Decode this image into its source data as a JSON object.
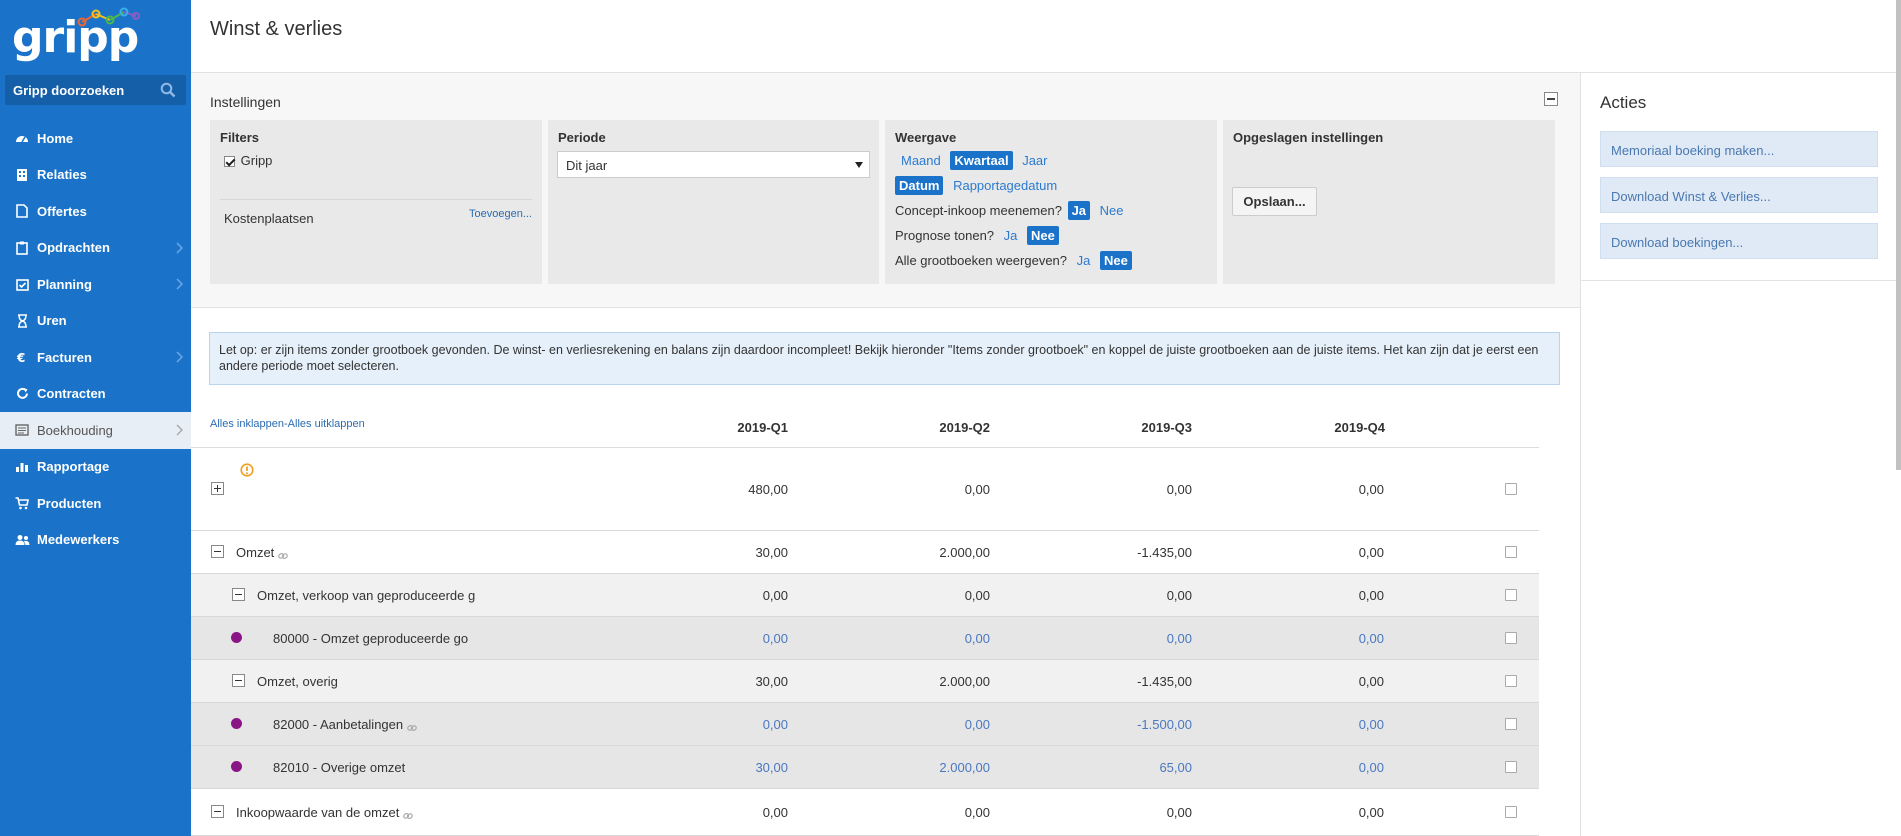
{
  "app": {
    "logo_text": "gripp"
  },
  "sidebar": {
    "search_label": "Gripp doorzoeken",
    "items": [
      {
        "label": "Home",
        "icon": "dashboard-icon",
        "chevron": false,
        "active": false
      },
      {
        "label": "Relaties",
        "icon": "building-icon",
        "chevron": false,
        "active": false
      },
      {
        "label": "Offertes",
        "icon": "file-icon",
        "chevron": false,
        "active": false
      },
      {
        "label": "Opdrachten",
        "icon": "clipboard-icon",
        "chevron": true,
        "active": false
      },
      {
        "label": "Planning",
        "icon": "calendar-check-icon",
        "chevron": true,
        "active": false
      },
      {
        "label": "Uren",
        "icon": "hourglass-icon",
        "chevron": false,
        "active": false
      },
      {
        "label": "Facturen",
        "icon": "euro-icon",
        "chevron": true,
        "active": false
      },
      {
        "label": "Contracten",
        "icon": "refresh-icon",
        "chevron": false,
        "active": false
      },
      {
        "label": "Boekhouding",
        "icon": "ledger-icon",
        "chevron": true,
        "active": true
      },
      {
        "label": "Rapportage",
        "icon": "bar-chart-icon",
        "chevron": false,
        "active": false
      },
      {
        "label": "Producten",
        "icon": "cart-icon",
        "chevron": false,
        "active": false
      },
      {
        "label": "Medewerkers",
        "icon": "users-icon",
        "chevron": false,
        "active": false
      }
    ]
  },
  "page": {
    "title": "Winst & verlies"
  },
  "settings": {
    "title": "Instellingen",
    "filters": {
      "title": "Filters",
      "gripp_label": "Gripp",
      "gripp_checked": true,
      "kostenplaatsen_label": "Kostenplaatsen",
      "add_link": "Toevoegen..."
    },
    "periode": {
      "title": "Periode",
      "selected": "Dit jaar"
    },
    "weergave": {
      "title": "Weergave",
      "interval_options": [
        "Maand",
        "Kwartaal",
        "Jaar"
      ],
      "interval_selected": "Kwartaal",
      "date_options": [
        "Datum",
        "Rapportagedatum"
      ],
      "date_selected": "Datum",
      "concept_label": "Concept-inkoop meenemen?",
      "concept_selected": "Ja",
      "prognose_label": "Prognose tonen?",
      "prognose_selected": "Nee",
      "alle_label": "Alle grootboeken weergeven?",
      "alle_selected": "Nee",
      "yes": "Ja",
      "no": "Nee"
    },
    "opgeslagen": {
      "title": "Opgeslagen instellingen",
      "save_button": "Opslaan..."
    }
  },
  "acties": {
    "title": "Acties",
    "buttons": [
      "Memoriaal boeking maken...",
      "Download Winst & Verlies...",
      "Download boekingen..."
    ]
  },
  "alert": "Let op: er zijn items zonder grootboek gevonden. De winst- en verliesrekening en balans zijn daardoor incompleet! Bekijk hieronder \"Items zonder grootboek\" en koppel de juiste grootboeken aan de juiste items. Het kan zijn dat je eerst een andere periode moet selecteren.",
  "table": {
    "collapse_all": "Alles inklappen",
    "separator": "-",
    "expand_all": "Alles uitklappen",
    "quarters": [
      "2019-Q1",
      "2019-Q2",
      "2019-Q3",
      "2019-Q4"
    ],
    "rows": [
      {
        "label": "",
        "values": [
          "480,00",
          "0,00",
          "0,00",
          "0,00"
        ],
        "warning": true
      },
      {
        "label": "Omzet",
        "values": [
          "30,00",
          "2.000,00",
          "-1.435,00",
          "0,00"
        ]
      },
      {
        "label": "Omzet, verkoop van geproduceerde g",
        "values": [
          "0,00",
          "0,00",
          "0,00",
          "0,00"
        ]
      },
      {
        "label": "80000 - Omzet geproduceerde go",
        "values": [
          "0,00",
          "0,00",
          "0,00",
          "0,00"
        ]
      },
      {
        "label": "Omzet, overig",
        "values": [
          "30,00",
          "2.000,00",
          "-1.435,00",
          "0,00"
        ]
      },
      {
        "label": "82000 - Aanbetalingen",
        "values": [
          "0,00",
          "0,00",
          "-1.500,00",
          "0,00"
        ]
      },
      {
        "label": "82010 - Overige omzet",
        "values": [
          "30,00",
          "2.000,00",
          "65,00",
          "0,00"
        ]
      },
      {
        "label": "Inkoopwaarde van de omzet",
        "values": [
          "0,00",
          "0,00",
          "0,00",
          "0,00"
        ]
      }
    ]
  },
  "colors": {
    "brand": "#1a73c9",
    "ledger_dot": "#8a1585",
    "warning": "#f0a020",
    "link": "#4a78c0"
  }
}
